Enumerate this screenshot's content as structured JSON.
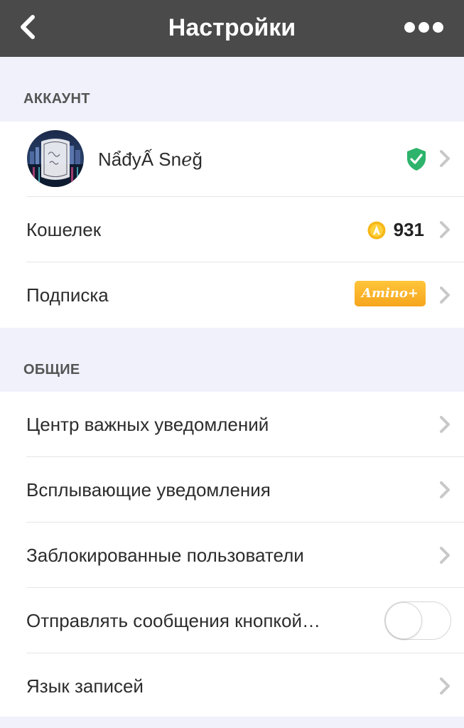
{
  "header": {
    "title": "Настройки",
    "back_icon": "chevron-left-icon",
    "more_icon": "more-dots-icon"
  },
  "account_section": {
    "title": "АККАУНТ",
    "profile": {
      "name": "NẩđуẤ Snℯğ",
      "verified_icon": "shield-check-icon",
      "verified_color": "#2db36b"
    },
    "wallet": {
      "label": "Кошелек",
      "coin_icon": "amino-coin-icon",
      "coins": "931"
    },
    "subscription": {
      "label": "Подписка",
      "badge": "Amino+"
    }
  },
  "general_section": {
    "title": "ОБЩИЕ",
    "items": [
      {
        "label": "Центр важных уведомлений",
        "type": "link"
      },
      {
        "label": "Всплывающие уведомления",
        "type": "link"
      },
      {
        "label": "Заблокированные пользователи",
        "type": "link"
      },
      {
        "label": "Отправлять сообщения кнопкой…",
        "type": "toggle",
        "enabled": false
      },
      {
        "label": "Язык записей",
        "type": "link"
      }
    ]
  },
  "colors": {
    "header_bg": "#4a4a4a",
    "page_bg": "#f0f1fb",
    "chevron": "#c8c8c8",
    "badge_orange": "#f6a51e"
  }
}
